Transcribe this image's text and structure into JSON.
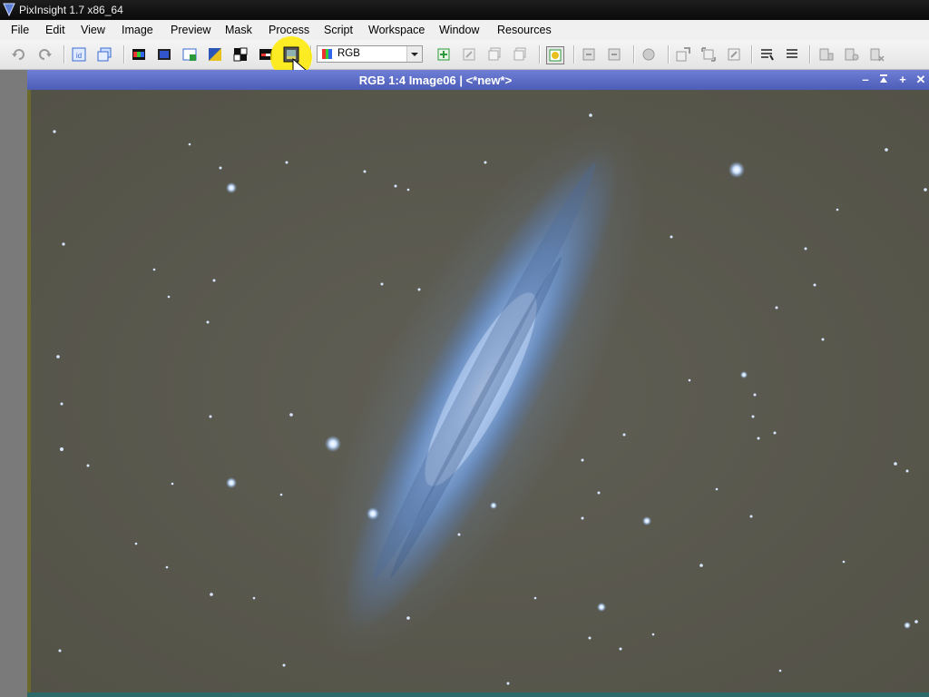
{
  "window": {
    "title": "PixInsight 1.7 x86_64"
  },
  "menu": [
    "File",
    "Edit",
    "View",
    "Image",
    "Preview",
    "Mask",
    "Process",
    "Script",
    "Workspace",
    "Window",
    "Resources"
  ],
  "toolbar": {
    "view_select_value": "RGB",
    "icons": [
      "undo-icon",
      "redo-icon",
      "identifier-icon",
      "clone-icon",
      "rgb-channels-icon",
      "extract-channels-icon",
      "new-image-icon",
      "invert-icon",
      "crop-icon",
      "histogram-icon",
      "stf-icon",
      "new-preview-icon",
      "edit-preview-icon",
      "delete-preview-icon",
      "store-preview-icon",
      "mask-icon",
      "enable-mask-icon",
      "show-mask-icon",
      "invert-mask-icon",
      "zoom-in-icon",
      "zoom-out-icon",
      "fit-view-icon",
      "pan-icon",
      "readout-icon",
      "layout-icon",
      "process-icon",
      "script-icon",
      "console-icon"
    ]
  },
  "image_window": {
    "title": "RGB 1:4 Image06 | <*new*>",
    "buttons": [
      "minimize",
      "shade",
      "maximize",
      "close"
    ]
  },
  "colors": {
    "titlebar": "#0f0f0f",
    "image_titlebar": "#5d6ec6",
    "sky": "#5b5a50",
    "galaxy": "#7fb0ee"
  }
}
